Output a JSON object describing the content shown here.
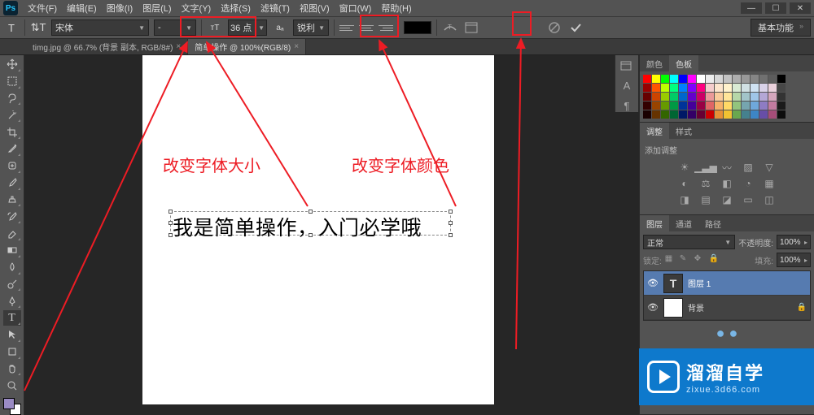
{
  "app": {
    "logo": "Ps"
  },
  "menu": {
    "items": [
      "文件(F)",
      "编辑(E)",
      "图像(I)",
      "图层(L)",
      "文字(Y)",
      "选择(S)",
      "滤镜(T)",
      "视图(V)",
      "窗口(W)",
      "帮助(H)"
    ]
  },
  "options": {
    "font_family": "宋体",
    "font_style": "-",
    "font_size": "36 点",
    "aa_label": "锐利",
    "aa_prefix": "aₐ",
    "workspace": "基本功能"
  },
  "tabs": [
    {
      "label": "timg.jpg @ 66.7% (背景 副本, RGB/8#)",
      "active": false
    },
    {
      "label": "简单操作 @ 100%(RGB/8)",
      "active": true
    }
  ],
  "canvas": {
    "text": "我是简单操作，入门必学哦"
  },
  "annotations": {
    "size_label": "改变字体大小",
    "color_label": "改变字体颜色"
  },
  "panels": {
    "swatch_tabs": [
      "颜色",
      "色板"
    ],
    "adjust_tabs": [
      "调整",
      "样式"
    ],
    "adjust_label": "添加调整",
    "layer_tabs": [
      "图层",
      "通道",
      "路径"
    ],
    "blend_mode": "正常",
    "opacity_label": "不透明度:",
    "opacity_value": "100%",
    "lock_label": "锁定:",
    "fill_label": "填充:",
    "fill_value": "100%",
    "layers": [
      {
        "name": "图层 1",
        "type": "text",
        "selected": true
      },
      {
        "name": "背景",
        "type": "bg",
        "selected": false,
        "locked": "🔒"
      }
    ]
  },
  "watermark": {
    "title": "溜溜自学",
    "url": "zixue.3d66.com"
  }
}
